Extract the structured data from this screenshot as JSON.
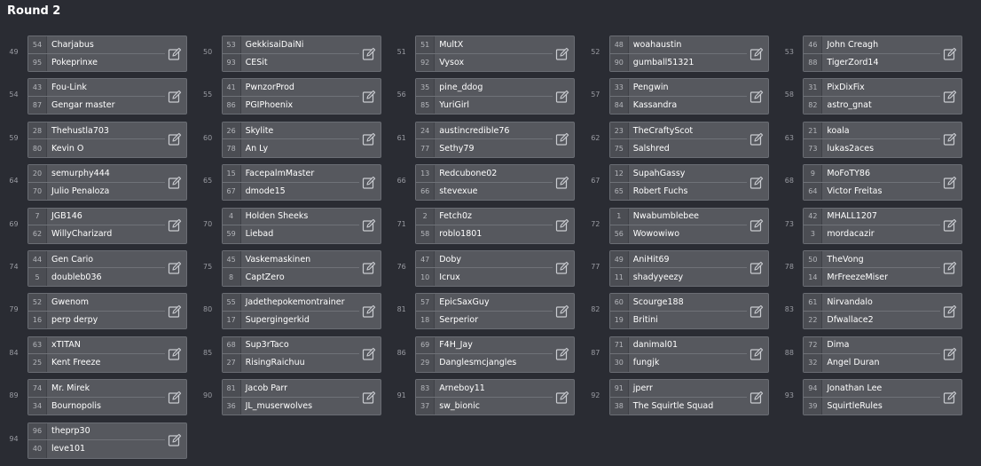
{
  "round_title": "Round 2",
  "matches": [
    {
      "num": "49",
      "p1": {
        "seed": "54",
        "name": "Charjabus"
      },
      "p2": {
        "seed": "95",
        "name": "Pokeprinxe"
      }
    },
    {
      "num": "50",
      "p1": {
        "seed": "53",
        "name": "GekkisaiDaiNi"
      },
      "p2": {
        "seed": "93",
        "name": "CESit"
      }
    },
    {
      "num": "51",
      "p1": {
        "seed": "51",
        "name": "MultX"
      },
      "p2": {
        "seed": "92",
        "name": "Vysox"
      }
    },
    {
      "num": "52",
      "p1": {
        "seed": "48",
        "name": "woahaustin"
      },
      "p2": {
        "seed": "90",
        "name": "gumball51321"
      }
    },
    {
      "num": "53",
      "p1": {
        "seed": "46",
        "name": "John Creagh"
      },
      "p2": {
        "seed": "88",
        "name": "TigerZord14"
      }
    },
    {
      "num": "54",
      "p1": {
        "seed": "43",
        "name": "Fou-Link"
      },
      "p2": {
        "seed": "87",
        "name": "Gengar master"
      }
    },
    {
      "num": "55",
      "p1": {
        "seed": "41",
        "name": "PwnzorProd"
      },
      "p2": {
        "seed": "86",
        "name": "PGIPhoenix"
      }
    },
    {
      "num": "56",
      "p1": {
        "seed": "35",
        "name": "pine_ddog"
      },
      "p2": {
        "seed": "85",
        "name": "YuriGirl"
      }
    },
    {
      "num": "57",
      "p1": {
        "seed": "33",
        "name": "Pengwin"
      },
      "p2": {
        "seed": "84",
        "name": "Kassandra"
      }
    },
    {
      "num": "58",
      "p1": {
        "seed": "31",
        "name": "PixDixFix"
      },
      "p2": {
        "seed": "82",
        "name": "astro_gnat"
      }
    },
    {
      "num": "59",
      "p1": {
        "seed": "28",
        "name": "Thehustla703"
      },
      "p2": {
        "seed": "80",
        "name": "Kevin O"
      }
    },
    {
      "num": "60",
      "p1": {
        "seed": "26",
        "name": "Skylite"
      },
      "p2": {
        "seed": "78",
        "name": "An Ly"
      }
    },
    {
      "num": "61",
      "p1": {
        "seed": "24",
        "name": "austincredible76"
      },
      "p2": {
        "seed": "77",
        "name": "Sethy79"
      }
    },
    {
      "num": "62",
      "p1": {
        "seed": "23",
        "name": "TheCraftyScot"
      },
      "p2": {
        "seed": "75",
        "name": "Salshred"
      }
    },
    {
      "num": "63",
      "p1": {
        "seed": "21",
        "name": "koala"
      },
      "p2": {
        "seed": "73",
        "name": "lukas2aces"
      }
    },
    {
      "num": "64",
      "p1": {
        "seed": "20",
        "name": "semurphy444"
      },
      "p2": {
        "seed": "70",
        "name": "Julio Penaloza"
      }
    },
    {
      "num": "65",
      "p1": {
        "seed": "15",
        "name": "FacepalmMaster"
      },
      "p2": {
        "seed": "67",
        "name": "dmode15"
      }
    },
    {
      "num": "66",
      "p1": {
        "seed": "13",
        "name": "Redcubone02"
      },
      "p2": {
        "seed": "66",
        "name": "stevexue"
      }
    },
    {
      "num": "67",
      "p1": {
        "seed": "12",
        "name": "SupahGassy"
      },
      "p2": {
        "seed": "65",
        "name": "Robert Fuchs"
      }
    },
    {
      "num": "68",
      "p1": {
        "seed": "9",
        "name": "MoFoTY86"
      },
      "p2": {
        "seed": "64",
        "name": "Victor Freitas"
      }
    },
    {
      "num": "69",
      "p1": {
        "seed": "7",
        "name": "JGB146"
      },
      "p2": {
        "seed": "62",
        "name": "WillyCharizard"
      }
    },
    {
      "num": "70",
      "p1": {
        "seed": "4",
        "name": "Holden Sheeks"
      },
      "p2": {
        "seed": "59",
        "name": "Liebad"
      }
    },
    {
      "num": "71",
      "p1": {
        "seed": "2",
        "name": "Fetch0z"
      },
      "p2": {
        "seed": "58",
        "name": "roblo1801"
      }
    },
    {
      "num": "72",
      "p1": {
        "seed": "1",
        "name": "Nwabumblebee"
      },
      "p2": {
        "seed": "56",
        "name": "Wowowiwo"
      }
    },
    {
      "num": "73",
      "p1": {
        "seed": "42",
        "name": "MHALL1207"
      },
      "p2": {
        "seed": "3",
        "name": "mordacazir"
      }
    },
    {
      "num": "74",
      "p1": {
        "seed": "44",
        "name": "Gen Cario"
      },
      "p2": {
        "seed": "5",
        "name": "doubleb036"
      }
    },
    {
      "num": "75",
      "p1": {
        "seed": "45",
        "name": "Vaskemaskinen"
      },
      "p2": {
        "seed": "8",
        "name": "CaptZero"
      }
    },
    {
      "num": "76",
      "p1": {
        "seed": "47",
        "name": "Doby"
      },
      "p2": {
        "seed": "10",
        "name": "Icrux"
      }
    },
    {
      "num": "77",
      "p1": {
        "seed": "49",
        "name": "AniHit69"
      },
      "p2": {
        "seed": "11",
        "name": "shadyyeezy"
      }
    },
    {
      "num": "78",
      "p1": {
        "seed": "50",
        "name": "TheVong"
      },
      "p2": {
        "seed": "14",
        "name": "MrFreezeMiser"
      }
    },
    {
      "num": "79",
      "p1": {
        "seed": "52",
        "name": "Gwenom"
      },
      "p2": {
        "seed": "16",
        "name": "perp derpy"
      }
    },
    {
      "num": "80",
      "p1": {
        "seed": "55",
        "name": "Jadethepokemontrainer"
      },
      "p2": {
        "seed": "17",
        "name": "Supergingerkid"
      }
    },
    {
      "num": "81",
      "p1": {
        "seed": "57",
        "name": "EpicSaxGuy"
      },
      "p2": {
        "seed": "18",
        "name": "Serperior"
      }
    },
    {
      "num": "82",
      "p1": {
        "seed": "60",
        "name": "Scourge188"
      },
      "p2": {
        "seed": "19",
        "name": "Britini"
      }
    },
    {
      "num": "83",
      "p1": {
        "seed": "61",
        "name": "Nirvandalo"
      },
      "p2": {
        "seed": "22",
        "name": "Dfwallace2"
      }
    },
    {
      "num": "84",
      "p1": {
        "seed": "63",
        "name": "xTITAN"
      },
      "p2": {
        "seed": "25",
        "name": "Kent Freeze"
      }
    },
    {
      "num": "85",
      "p1": {
        "seed": "68",
        "name": "Sup3rTaco"
      },
      "p2": {
        "seed": "27",
        "name": "RisingRaichuu"
      }
    },
    {
      "num": "86",
      "p1": {
        "seed": "69",
        "name": "F4H_Jay"
      },
      "p2": {
        "seed": "29",
        "name": "Danglesmcjangles"
      }
    },
    {
      "num": "87",
      "p1": {
        "seed": "71",
        "name": "danimal01"
      },
      "p2": {
        "seed": "30",
        "name": "fungjk"
      }
    },
    {
      "num": "88",
      "p1": {
        "seed": "72",
        "name": "Dima"
      },
      "p2": {
        "seed": "32",
        "name": "Angel Duran"
      }
    },
    {
      "num": "89",
      "p1": {
        "seed": "74",
        "name": "Mr. Mirek"
      },
      "p2": {
        "seed": "34",
        "name": "Bournopolis"
      }
    },
    {
      "num": "90",
      "p1": {
        "seed": "81",
        "name": "Jacob Parr"
      },
      "p2": {
        "seed": "36",
        "name": "JL_muserwolves"
      }
    },
    {
      "num": "91",
      "p1": {
        "seed": "83",
        "name": "Arneboy11"
      },
      "p2": {
        "seed": "37",
        "name": "sw_bionic"
      }
    },
    {
      "num": "92",
      "p1": {
        "seed": "91",
        "name": "jperr"
      },
      "p2": {
        "seed": "38",
        "name": "The Squirtle Squad"
      }
    },
    {
      "num": "93",
      "p1": {
        "seed": "94",
        "name": "Jonathan Lee"
      },
      "p2": {
        "seed": "39",
        "name": "SquirtleRules"
      }
    },
    {
      "num": "94",
      "p1": {
        "seed": "96",
        "name": "theprp30"
      },
      "p2": {
        "seed": "40",
        "name": "leve101"
      }
    }
  ],
  "icons": {
    "edit": "edit-pencil-icon"
  },
  "colors": {
    "background": "#2a2c33",
    "box": "#56585e",
    "seed_bg": "#4b4d53"
  }
}
